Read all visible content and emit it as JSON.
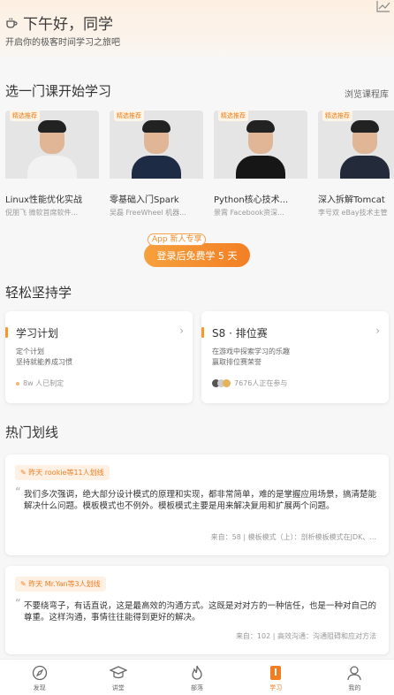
{
  "header": {
    "greeting": "下午好，同学",
    "subtitle": "开启你的极客时间学习之旅吧",
    "icons": [
      "cup-icon",
      "trend-icon"
    ]
  },
  "courses_section": {
    "title": "选一门课开始学习",
    "browse_label": "浏览课程库",
    "items": [
      {
        "badge": "精选推荐",
        "title": "Linux性能优化实战",
        "author": "倪朋飞 微软首席软件..."
      },
      {
        "badge": "精选推荐",
        "title": "零基础入门Spark",
        "author": "吴磊 FreeWheel 机器..."
      },
      {
        "badge": "精选推荐",
        "title": "Python核心技术...",
        "author": "景霄 Facebook资深..."
      },
      {
        "badge": "精选推荐",
        "title": "深入拆解Tomcat",
        "author": "李号双 eBay技术主管"
      }
    ],
    "promo_tag": "App 新人专享",
    "promo_button": "登录后免费学 5 天"
  },
  "persist_section": {
    "title": "轻松坚持学",
    "plan": {
      "title": "学习计划",
      "line1": "定个计划",
      "line2": "坚持就能养成习惯",
      "footer": "8w 人已制定"
    },
    "rank": {
      "title": "S8 · 排位赛",
      "line1": "在游戏中探索学习的乐趣",
      "line2": "赢取排位赛荣誉",
      "footer": "7676人正在参与"
    }
  },
  "highlights_section": {
    "title": "热门划线",
    "items": [
      {
        "tag": "昨天 rookie等11人划线",
        "text": "我们多次强调，绝大部分设计模式的原理和实现，都非常简单，难的是掌握应用场景，搞清楚能解决什么问题。模板模式也不例外。模板模式主要是用来解决复用和扩展两个问题。",
        "source": "来自：58 | 模板模式（上）：剖析模板模式在JDK、..."
      },
      {
        "tag": "昨天 Mr.Yan等3人划线",
        "text": "不要绕弯子，有话直说，这是最高效的沟通方式。这既是对对方的一种信任，也是一种对自己的尊重。这样沟通，事情往往能得到更好的解决。",
        "source": "来自：102 | 高效沟通：沟通阻碍和应对方法"
      }
    ]
  },
  "tabbar": {
    "items": [
      {
        "label": "发现",
        "icon": "compass-icon"
      },
      {
        "label": "讲堂",
        "icon": "graduation-icon"
      },
      {
        "label": "部落",
        "icon": "flame-icon"
      },
      {
        "label": "学习",
        "icon": "book-icon"
      },
      {
        "label": "我的",
        "icon": "user-icon"
      }
    ],
    "active": "学习"
  },
  "colors": {
    "accent": "#f27d22",
    "background": "#f7f7f7"
  }
}
